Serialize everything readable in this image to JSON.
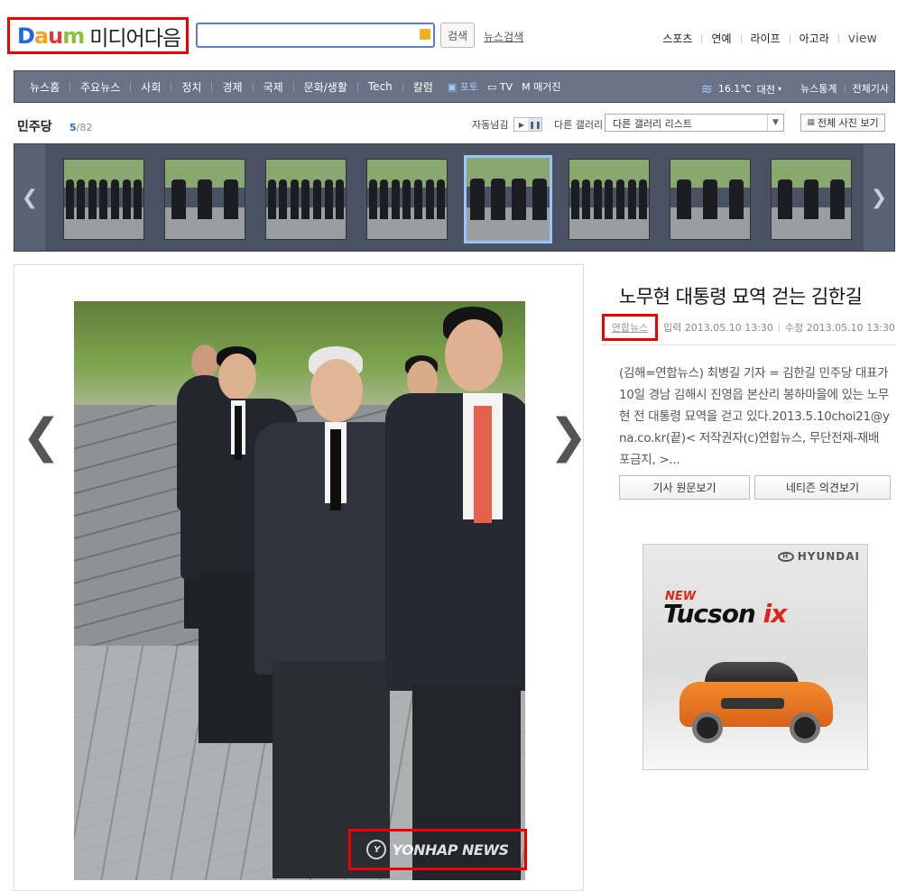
{
  "header": {
    "logo_daum": [
      "D",
      "a",
      "u",
      "m"
    ],
    "logo_text": "미디어다음",
    "search_button": "검색",
    "news_search": "뉴스검색",
    "top_menu": [
      "스포츠",
      "연예",
      "라이프",
      "아고라",
      "view"
    ]
  },
  "nav": {
    "items": [
      "뉴스홈",
      "주요뉴스",
      "사회",
      "정치",
      "경제",
      "국제",
      "문화/생활",
      "Tech",
      "칼럼"
    ],
    "media": [
      "포토",
      "TV",
      "매거진"
    ],
    "weather": {
      "temp": "16.1℃",
      "city": "대전"
    },
    "right": [
      "뉴스통계",
      "전체기사"
    ]
  },
  "gallery": {
    "title": "민주당",
    "current": "5",
    "total": "/82",
    "autoplay_label": "자동넘김",
    "other_gallery_label": "다른 갤러리",
    "other_gallery_select": "다른 갤러리 리스트",
    "all_photos": "전체 사진 보기",
    "thumbnail_count": 8,
    "active_index": 4
  },
  "article": {
    "headline": "노무현 대통령 묘역 걷는 김한길",
    "source": "연합뉴스",
    "input_time": "입력 2013.05.10 13:30",
    "edit_time": "수정 2013.05.10 13:30",
    "body": "(김해=연합뉴스) 최병길 기자 = 김한길 민주당 대표가 10일 경남 김해시 진영읍 본산리 봉하마을에 있는 노무현 전 대통령 묘역을 걷고 있다.2013.5.10choi21@yna.co.kr(끝)< 저작권자(c)연합뉴스, 무단전재-재배포금지, >...",
    "btn_original": "기사 원문보기",
    "btn_opinion": "네티즌 의견보기"
  },
  "photo": {
    "watermark": "YONHAP NEWS"
  },
  "ad": {
    "brand": "HYUNDAI",
    "new_label": "NEW",
    "model": "Tucson",
    "model_suffix": "ix"
  },
  "colors": {
    "nav_bg": "#6a7386",
    "strip_bg": "#4a5163",
    "highlight_red": "#e00000",
    "active_thumb_border": "#9bc4ff",
    "link_blue": "#2b6cd0"
  }
}
